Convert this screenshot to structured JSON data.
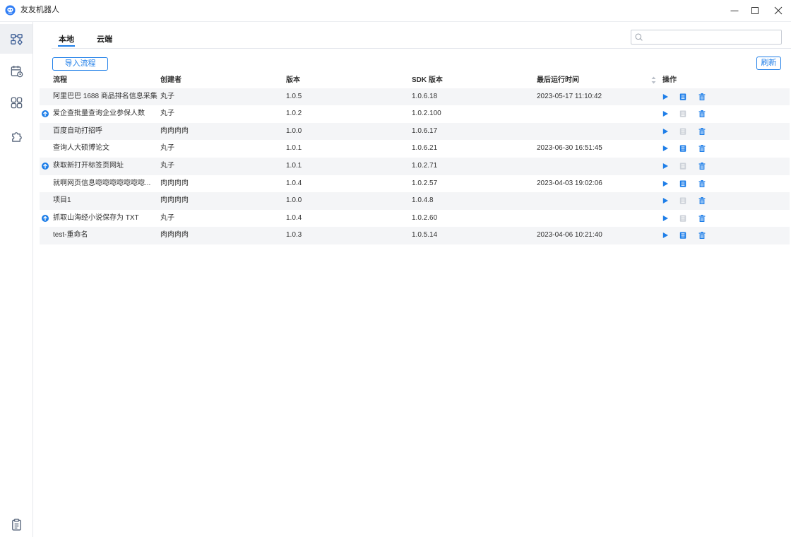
{
  "app": {
    "title": "友友机器人"
  },
  "icons": {
    "logo": "robot-logo-icon",
    "minimize": "minimize-icon",
    "maximize": "maximize-icon",
    "close": "close-icon",
    "search": "search-icon",
    "sort": "sort-icon",
    "run": "play-icon",
    "log": "list-icon",
    "delete": "trash-icon",
    "update": "arrow-up-circle-icon"
  },
  "sidebar": {
    "items": [
      {
        "icon": "flowchart-icon",
        "active": true
      },
      {
        "icon": "calendar-clock-icon",
        "active": false
      },
      {
        "icon": "grid-icon",
        "active": false
      },
      {
        "icon": "puzzle-icon",
        "active": false
      }
    ],
    "bottom_item": {
      "icon": "clipboard-icon"
    }
  },
  "tabs": [
    {
      "label": "本地",
      "active": true
    },
    {
      "label": "云端",
      "active": false
    }
  ],
  "search": {
    "value": ""
  },
  "toolbar": {
    "import_label": "导入流程",
    "refresh_label": "刷新"
  },
  "table": {
    "columns": {
      "name": "流程",
      "creator": "创建者",
      "version": "版本",
      "sdk_version": "SDK 版本",
      "last_run": "最后运行时间",
      "actions": "操作"
    },
    "rows": [
      {
        "name": "阿里巴巴 1688 商品排名信息采集",
        "creator": "丸子",
        "version": "1.0.5",
        "sdk_version": "1.0.6.18",
        "last_run": "2023-05-17 11:10:42",
        "has_update": false,
        "log_enabled": true
      },
      {
        "name": "爱企查批量查询企业参保人数",
        "creator": "丸子",
        "version": "1.0.2",
        "sdk_version": "1.0.2.100",
        "last_run": "",
        "has_update": true,
        "log_enabled": false
      },
      {
        "name": "百度自动打招呼",
        "creator": "肉肉肉肉",
        "version": "1.0.0",
        "sdk_version": "1.0.6.17",
        "last_run": "",
        "has_update": false,
        "log_enabled": false
      },
      {
        "name": "查询人大硕博论文",
        "creator": "丸子",
        "version": "1.0.1",
        "sdk_version": "1.0.6.21",
        "last_run": "2023-06-30 16:51:45",
        "has_update": false,
        "log_enabled": true
      },
      {
        "name": "获取新打开标签页网址",
        "creator": "丸子",
        "version": "1.0.1",
        "sdk_version": "1.0.2.71",
        "last_run": "",
        "has_update": true,
        "log_enabled": false
      },
      {
        "name": "就啊网页信息唿唿唿唿唿唿唿...",
        "creator": "肉肉肉肉",
        "version": "1.0.4",
        "sdk_version": "1.0.2.57",
        "last_run": "2023-04-03 19:02:06",
        "has_update": false,
        "log_enabled": true
      },
      {
        "name": "项目1",
        "creator": "肉肉肉肉",
        "version": "1.0.0",
        "sdk_version": "1.0.4.8",
        "last_run": "",
        "has_update": false,
        "log_enabled": false
      },
      {
        "name": "抓取山海经小说保存为 TXT",
        "creator": "丸子",
        "version": "1.0.4",
        "sdk_version": "1.0.2.60",
        "last_run": "",
        "has_update": true,
        "log_enabled": false
      },
      {
        "name": "test-重命名",
        "creator": "肉肉肉肉",
        "version": "1.0.3",
        "sdk_version": "1.0.5.14",
        "last_run": "2023-04-06 10:21:40",
        "has_update": false,
        "log_enabled": true
      }
    ]
  },
  "colors": {
    "accent": "#1e7ee8",
    "row_alt": "#f4f5f7",
    "icon_disabled": "#cdd2d9",
    "text": "#333333",
    "sidebar_active_bg": "#eef0f3",
    "logo": "#2f7df5"
  }
}
